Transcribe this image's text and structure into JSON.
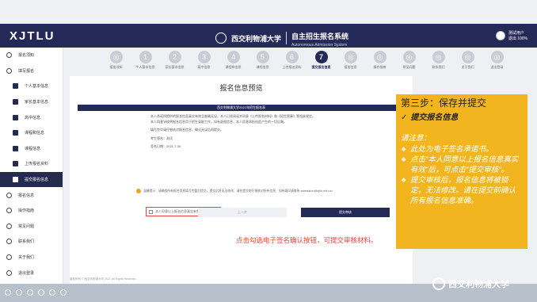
{
  "header": {
    "logo": "XJTLU",
    "univ_cn": "西交利物浦大学",
    "univ_en": "Xi'an Jiaotong-Liverpool University",
    "system_title": "自主招生报名系统",
    "system_sub": "Autonomous Admission System",
    "user_line1": "测试用户",
    "user_line2": "退出 100%"
  },
  "sidebar": {
    "items": [
      {
        "label": "报名须知",
        "type": "top"
      },
      {
        "label": "填写报名",
        "type": "top"
      },
      {
        "label": "个人基本信息",
        "type": "sub"
      },
      {
        "label": "家长基本信息",
        "type": "sub"
      },
      {
        "label": "高中信息",
        "type": "sub"
      },
      {
        "label": "课程和信息",
        "type": "sub"
      },
      {
        "label": "课程信息",
        "type": "sub"
      },
      {
        "label": "上传报名资料",
        "type": "sub"
      },
      {
        "label": "提交报名信息",
        "type": "sub",
        "active": true
      },
      {
        "label": "报名信息",
        "type": "top"
      },
      {
        "label": "操作指南",
        "type": "top"
      },
      {
        "label": "常见问题",
        "type": "top"
      },
      {
        "label": "联系我们",
        "type": "top"
      },
      {
        "label": "关于我们",
        "type": "top"
      },
      {
        "label": "退出登录",
        "type": "top"
      }
    ]
  },
  "steps": [
    {
      "n": "◎",
      "label": "报名须知"
    },
    {
      "n": "1",
      "label": "个人基本信息"
    },
    {
      "n": "2",
      "label": "家长基本信息"
    },
    {
      "n": "3",
      "label": "高中信息"
    },
    {
      "n": "4",
      "label": "课程和信息"
    },
    {
      "n": "5",
      "label": "课程信息"
    },
    {
      "n": "6",
      "label": "上传报名资料"
    },
    {
      "n": "7",
      "label": "提交报名信息",
      "active": true
    },
    {
      "n": "◎",
      "label": "报名信息"
    },
    {
      "n": "◎",
      "label": "操作指南"
    },
    {
      "n": "◎",
      "label": "常见问题"
    },
    {
      "n": "◎",
      "label": "联系我们"
    },
    {
      "n": "◎",
      "label": "关于我们"
    },
    {
      "n": "◎",
      "label": "退出登录"
    }
  ],
  "main": {
    "title": "报名信息预览",
    "doc_header": "西交利物浦大学2021年招生报名表",
    "doc_lines": [
      "本人承诺所提供的报名信息真实有效且准确无误。本人已经阅读并同意《上传报名材料》和《招生简章》等相关规定。",
      "本人同意学校将报名信息用于招生录取工作，如有虚假信息，本人愿意承担由此产生的一切后果。"
    ],
    "doc_note": "填写完毕请仔细核对报名信息，确认无误后再提交。",
    "signer": "考生签名：测试",
    "date": "签名日期：2021-7-30",
    "checkbox_label": "本人同意以上报名信息真实有效",
    "hint": "点击勾选电子签名确认按钮，可提交审核材料。",
    "notice": "温馨提示：请确保所有报名信息填写完整后提交，提交后将无法修改，请在提交前仔细核对所有信息，如有疑问请联系 admission@xjtlu.edu.cn",
    "prev_button": "上一步",
    "submit_button": "提交审核",
    "footer": "版权所有 © 西交利物浦大学 2021 All Rights Reserved"
  },
  "callout": {
    "title": "第三步：保存并提交",
    "subtitle": "提交报名信息",
    "note_label": "请注意：",
    "points": [
      "此处为电子签名承诺书。",
      "点击\"本人同意以上报名信息真实有效\"后，可点击\"提交审核\"。",
      "提交审核后，报名信息将被锁定，无法修改。请在提交前确认所有报名信息准确。"
    ]
  },
  "footer_brand": "西交利物浦大学"
}
